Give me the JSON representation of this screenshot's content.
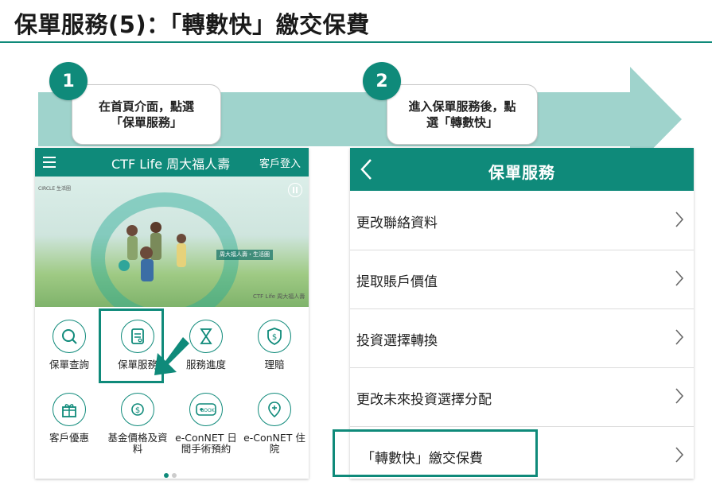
{
  "title": "保單服務(5)：「轉數快」繳交保費",
  "colors": {
    "accent": "#0f8a7a",
    "arrow": "#9fd3cc"
  },
  "steps": [
    {
      "number": "1",
      "line1": "在首頁介面，點選",
      "line2": "「保單服務」"
    },
    {
      "number": "2",
      "line1": "進入保單服務後，點",
      "line2": "選「轉數快」"
    }
  ],
  "phone1": {
    "menu_icon": "hamburger-icon",
    "brand": "CTF Life 周大福人壽",
    "login": "客戶登入",
    "banner": {
      "circle_logo": "CIRCLE 生活圈",
      "slogan": "周大福人壽・生活圈",
      "brand": "CTF Life 周大福人壽"
    },
    "tiles": [
      {
        "label": "保單查詢",
        "icon": "search-icon"
      },
      {
        "label": "保單服務",
        "icon": "document-icon"
      },
      {
        "label": "服務進度",
        "icon": "hourglass-icon"
      },
      {
        "label": "理賠",
        "icon": "dollar-shield-icon"
      },
      {
        "label": "客戶優惠",
        "icon": "gift-icon"
      },
      {
        "label": "基金價格及資料",
        "icon": "dollar-growth-icon"
      },
      {
        "label": "e-ConNET 日間手術預約",
        "icon": "book-icon"
      },
      {
        "label": "e-ConNET 住院",
        "icon": "location-pin-icon"
      }
    ]
  },
  "phone2": {
    "title": "保單服務",
    "items": [
      "更改聯絡資料",
      "提取賬戶價值",
      "投資選擇轉換",
      "更改未來投資選擇分配",
      "「轉數快」繳交保費"
    ]
  }
}
